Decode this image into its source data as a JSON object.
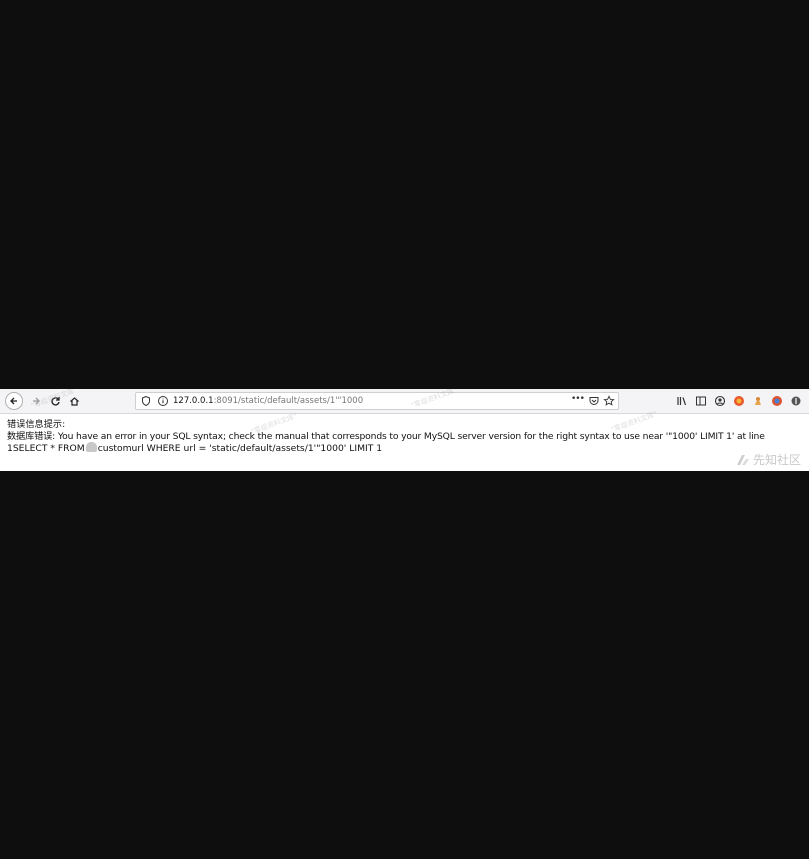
{
  "browser": {
    "nav": {
      "back_icon": "back-arrow-icon",
      "forward_icon": "forward-arrow-icon",
      "reload_icon": "reload-icon",
      "home_icon": "home-icon"
    },
    "urlbar": {
      "host": "127.0.0.1",
      "rest": ":8091/static/default/assets/1'\"1000",
      "more_label": "•••"
    },
    "right_icons": [
      "library-icon",
      "sidebar-icon",
      "account-icon",
      "extension-icon",
      "extension-icon-2",
      "extension-icon-3",
      "extension-icon-4"
    ]
  },
  "page": {
    "line1": "错误信息提示:",
    "line2": "数据库错误:  You have an error in your SQL syntax; check the manual that corresponds to your MySQL server version for the right syntax to use near '\"1000' LIMIT 1' at line",
    "line3_prefix": "1SELECT * FROM",
    "line3_suffix": "customurl WHERE url = 'static/default/assets/1'\"1000' LIMIT 1"
  },
  "watermark": {
    "text": "\"零组资料文库\"",
    "brand": "先知社区"
  },
  "colors": {
    "background": "#0e0e0e",
    "toolbar": "#f4f4f6",
    "page": "#ffffff"
  }
}
